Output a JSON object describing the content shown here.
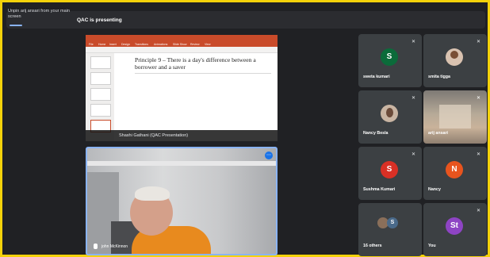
{
  "header": {
    "unpin_text": "Unpin arij ansari from your main screen",
    "presenting_text": "QAC is presenting"
  },
  "presentation": {
    "slide_title": "Principle 9 – There is a day's difference between a borrower and a saver",
    "caption": "Shashi Gathani (QAC Presentation)",
    "ribbon_tabs": [
      "File",
      "Home",
      "Insert",
      "Design",
      "Transitions",
      "Animations",
      "Slide Show",
      "Review",
      "View"
    ]
  },
  "main_video": {
    "name": "john McKinnon"
  },
  "participants": [
    {
      "name": "sweta kumari",
      "initial": "S",
      "color": "#0b6b3a"
    },
    {
      "name": "smita tigga",
      "initial": "",
      "color": ""
    },
    {
      "name": "Nancy Besla",
      "initial": "",
      "color": ""
    },
    {
      "name": "arij ansari",
      "initial": "",
      "color": ""
    },
    {
      "name": "Sushma Kumari",
      "initial": "S",
      "color": "#d93025"
    },
    {
      "name": "Nancy",
      "initial": "N",
      "color": "#e8541e"
    },
    {
      "name": "16 others",
      "initial": "S",
      "color": "#4a6a8a"
    },
    {
      "name": "You",
      "initial": "St",
      "color": "#8e44c4"
    }
  ]
}
